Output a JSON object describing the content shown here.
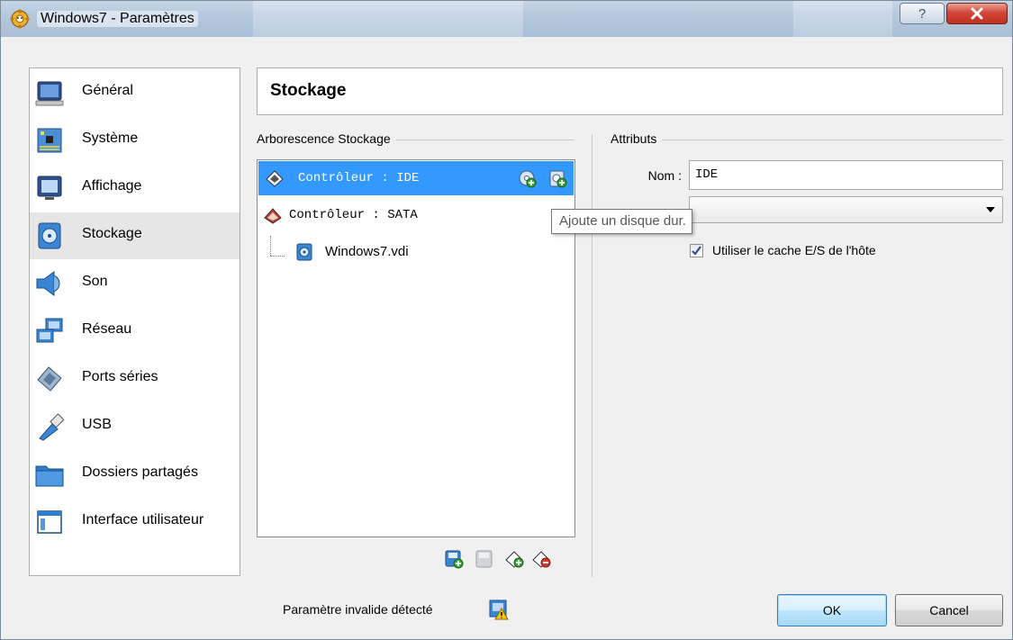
{
  "window": {
    "title": "Windows7 - Paramètres",
    "accent": "#3399ff"
  },
  "nav": {
    "items": [
      {
        "label": "Général",
        "icon": "monitor-icon"
      },
      {
        "label": "Système",
        "icon": "motherboard-icon"
      },
      {
        "label": "Affichage",
        "icon": "display-icon"
      },
      {
        "label": "Stockage",
        "icon": "storage-disk-icon",
        "selected": true
      },
      {
        "label": "Son",
        "icon": "speaker-icon"
      },
      {
        "label": "Réseau",
        "icon": "network-icon"
      },
      {
        "label": "Ports séries",
        "icon": "serial-port-icon"
      },
      {
        "label": "USB",
        "icon": "usb-icon"
      },
      {
        "label": "Dossiers partagés",
        "icon": "folder-icon"
      },
      {
        "label": "Interface utilisateur",
        "icon": "window-icon"
      }
    ]
  },
  "header": {
    "title": "Stockage"
  },
  "storage_tree": {
    "group_title": "Arborescence Stockage",
    "items": [
      {
        "label": "Contrôleur : IDE",
        "selected": true,
        "icon": "ide-controller-icon"
      },
      {
        "label": "Contrôleur : SATA",
        "selected": false,
        "icon": "sata-controller-icon"
      },
      {
        "label": "Windows7.vdi",
        "selected": false,
        "icon": "hard-disk-icon"
      }
    ]
  },
  "attributes": {
    "group_title": "Attributs",
    "name_label": "Nom :",
    "name_value": "IDE",
    "type_value": "",
    "cache_label": "Utiliser le cache E/S de l'hôte",
    "cache_checked": true
  },
  "tooltip": {
    "text": "Ajoute un disque dur."
  },
  "footer": {
    "status": "Paramètre invalide détecté",
    "ok": "OK",
    "cancel": "Cancel"
  }
}
